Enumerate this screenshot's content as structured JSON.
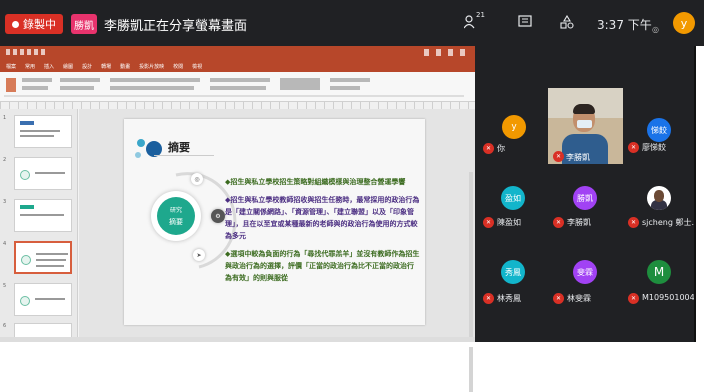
{
  "meet": {
    "recording_label": "錄製中",
    "sharer_chip": "勝凱",
    "share_status": "李勝凱正在分享螢幕畫面",
    "participant_count": "21",
    "time": "3:37 下午",
    "self_avatar": "y"
  },
  "ppt": {
    "tabs": [
      "檔案",
      "常用",
      "插入",
      "繪圖",
      "設計",
      "轉場",
      "動畫",
      "投影片放映",
      "校閱",
      "檢視"
    ]
  },
  "slide": {
    "title": "摘要",
    "center_label_top": "研究",
    "center_label_bottom": "摘要",
    "paragraphs": [
      {
        "text": "◆招生與私立學校招生策略對組織模樣與治理整合營運學響",
        "tone": "green"
      },
      {
        "text": "◆招生與私立學校教師招收與招生任務時，最常採用的政治行為是「建立關係網路」、「資源管理」、「建立聯盟」以及「印象管理」，且在以至宜或某種最新的老師與的政治行為使用的方式較為多元",
        "tone": "purple"
      },
      {
        "text": "◆選項中較為負面的行為「尋找代罪羔羊」並沒有教師作為招生與政治行為的選擇，評價「正當的政治行為比不正當的政治行為有效」的則與服從",
        "tone": "green"
      }
    ]
  },
  "participants": [
    {
      "name": "你",
      "avatar": "y",
      "color": "#f29900"
    },
    {
      "name": "李勝凱",
      "video": true
    },
    {
      "name": "廖悌餃",
      "avatar": "悌餃",
      "color": "#1a73e8"
    },
    {
      "name": "陳盈如",
      "avatar": "盈如",
      "color": "#12b5cb"
    },
    {
      "name": "李勝凱",
      "avatar": "勝凱",
      "color": "#a142f4"
    },
    {
      "name": "sjcheng 鄭士...",
      "photo": true
    },
    {
      "name": "林秀鳳",
      "avatar": "秀鳳",
      "color": "#12b5cb"
    },
    {
      "name": "林斐霖",
      "avatar": "斐霖",
      "color": "#a142f4"
    },
    {
      "name": "M109501004...",
      "avatar": "M",
      "color": "#1e8e3e"
    }
  ]
}
